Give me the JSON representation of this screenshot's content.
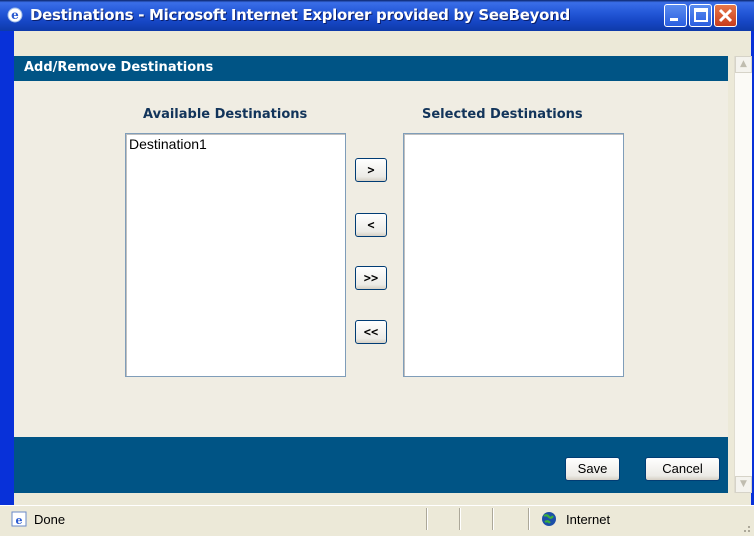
{
  "window": {
    "title": "Destinations - Microsoft Internet Explorer provided by SeeBeyond",
    "icon": "ie-icon",
    "controls": [
      "minimize",
      "maximize",
      "close"
    ]
  },
  "dialog": {
    "header": "Add/Remove Destinations",
    "available": {
      "label": "Available Destinations",
      "items": [
        "Destination1"
      ]
    },
    "selected": {
      "label": "Selected Destinations",
      "items": []
    },
    "move_buttons": {
      "add": ">",
      "remove": "<",
      "add_all": ">>",
      "remove_all": "<<"
    },
    "save_label": "Save",
    "cancel_label": "Cancel"
  },
  "statusbar": {
    "status": "Done",
    "zone": "Internet"
  },
  "colors": {
    "header_band": "#005485",
    "title_bar": "#2458d8",
    "label_text": "#12345a"
  }
}
